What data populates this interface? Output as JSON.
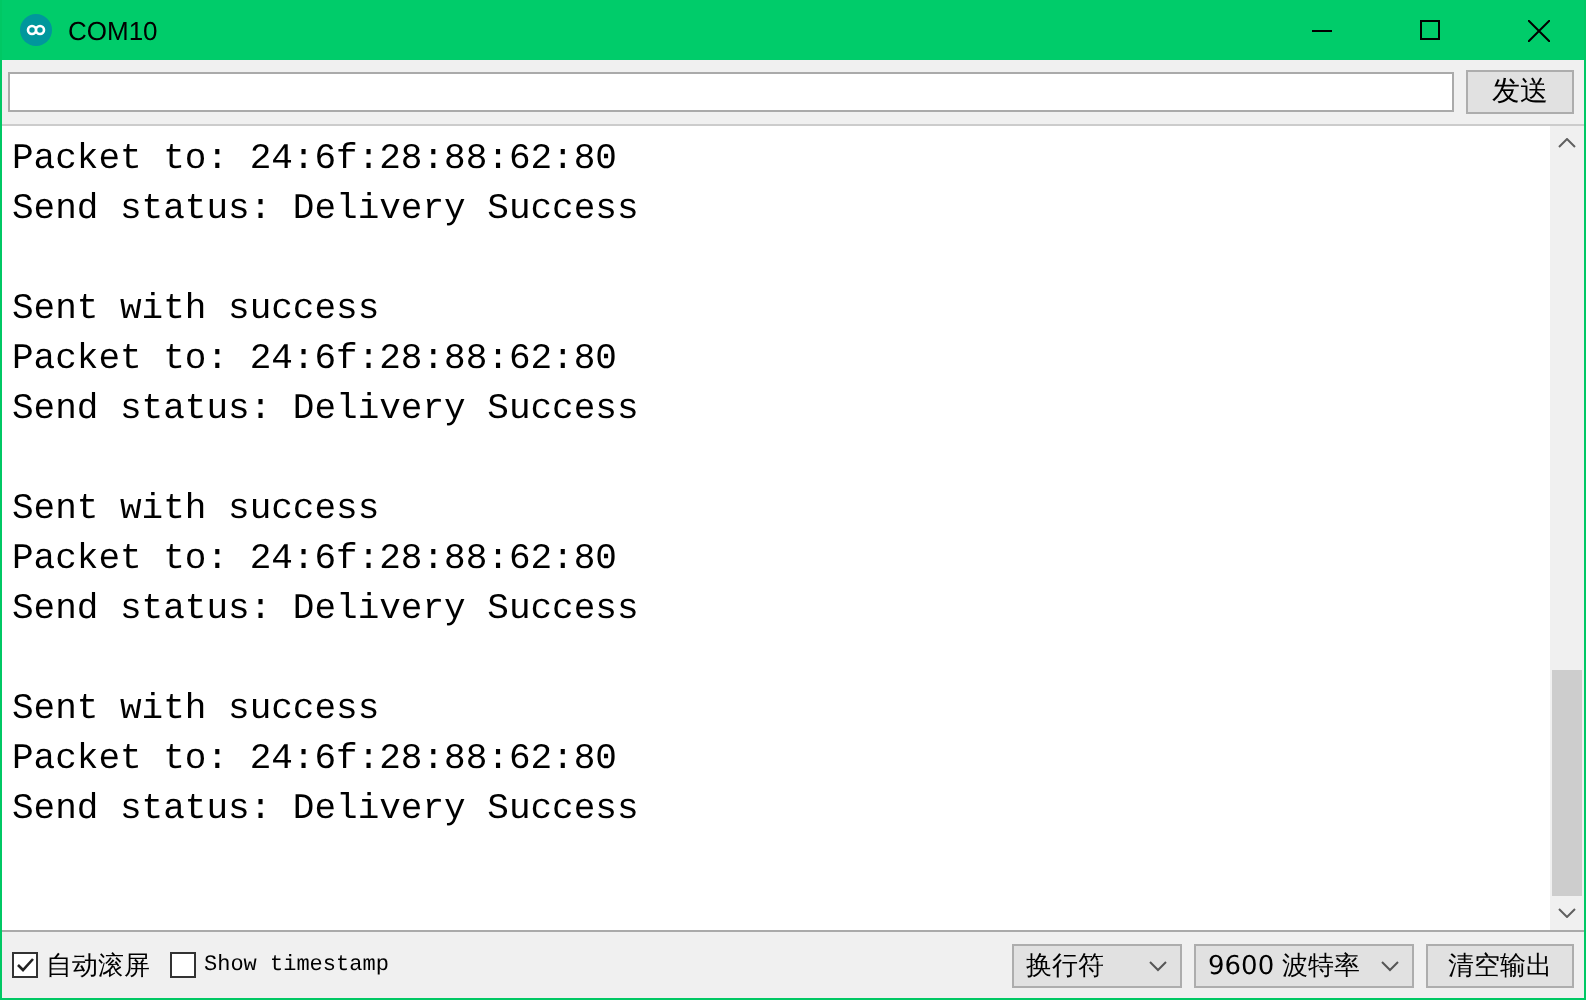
{
  "window": {
    "title": "COM10"
  },
  "send": {
    "button": "发送"
  },
  "output": {
    "blocks": [
      {
        "lines": [
          "Packet to: 24:6f:28:88:62:80",
          "Send status: Delivery Success"
        ]
      },
      {
        "lines": [
          "Sent with success",
          "Packet to: 24:6f:28:88:62:80",
          "Send status: Delivery Success"
        ]
      },
      {
        "lines": [
          "Sent with success",
          "Packet to: 24:6f:28:88:62:80",
          "Send status: Delivery Success"
        ]
      },
      {
        "lines": [
          "Sent with success",
          "Packet to: 24:6f:28:88:62:80",
          "Send status: Delivery Success"
        ]
      }
    ]
  },
  "status_bar": {
    "autoscroll": {
      "label": "自动滚屏",
      "checked": true
    },
    "timestamp": {
      "label": "Show timestamp",
      "checked": false
    },
    "line_ending": "换行符",
    "baud": "9600 波特率",
    "clear_button": "清空输出"
  }
}
